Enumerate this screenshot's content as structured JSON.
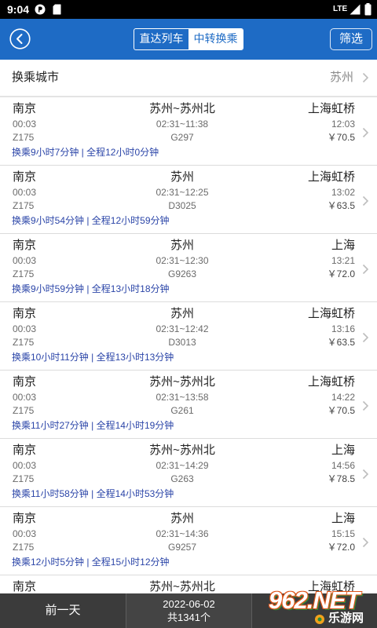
{
  "status_bar": {
    "time": "9:04",
    "network": "LTE",
    "icons": {
      "app": "app-notification-icon",
      "sim": "sim-card-icon",
      "signal": "signal-icon",
      "battery": "battery-icon"
    }
  },
  "header": {
    "back_icon": "back-circle-icon",
    "tabs": [
      {
        "label": "直达列车",
        "selected": false
      },
      {
        "label": "中转换乘",
        "selected": true
      }
    ],
    "filter_label": "筛选"
  },
  "transfer_city": {
    "label": "换乘城市",
    "value": "苏州",
    "icon": "chevron-right-icon"
  },
  "results": [
    {
      "from": "南京",
      "via": "苏州~苏州北",
      "to": "上海虹桥",
      "depart": "00:03",
      "transfer": "02:31~11:38",
      "arrive": "12:03",
      "train1": "Z175",
      "train2": "G297",
      "price": "￥70.5",
      "summary": "换乘9小时7分钟 | 全程12小时0分钟"
    },
    {
      "from": "南京",
      "via": "苏州",
      "to": "上海虹桥",
      "depart": "00:03",
      "transfer": "02:31~12:25",
      "arrive": "13:02",
      "train1": "Z175",
      "train2": "D3025",
      "price": "￥63.5",
      "summary": "换乘9小时54分钟 | 全程12小时59分钟"
    },
    {
      "from": "南京",
      "via": "苏州",
      "to": "上海",
      "depart": "00:03",
      "transfer": "02:31~12:30",
      "arrive": "13:21",
      "train1": "Z175",
      "train2": "G9263",
      "price": "￥72.0",
      "summary": "换乘9小时59分钟 | 全程13小时18分钟"
    },
    {
      "from": "南京",
      "via": "苏州",
      "to": "上海虹桥",
      "depart": "00:03",
      "transfer": "02:31~12:42",
      "arrive": "13:16",
      "train1": "Z175",
      "train2": "D3013",
      "price": "￥63.5",
      "summary": "换乘10小时11分钟 | 全程13小时13分钟"
    },
    {
      "from": "南京",
      "via": "苏州~苏州北",
      "to": "上海虹桥",
      "depart": "00:03",
      "transfer": "02:31~13:58",
      "arrive": "14:22",
      "train1": "Z175",
      "train2": "G261",
      "price": "￥70.5",
      "summary": "换乘11小时27分钟 | 全程14小时19分钟"
    },
    {
      "from": "南京",
      "via": "苏州~苏州北",
      "to": "上海",
      "depart": "00:03",
      "transfer": "02:31~14:29",
      "arrive": "14:56",
      "train1": "Z175",
      "train2": "G263",
      "price": "￥78.5",
      "summary": "换乘11小时58分钟 | 全程14小时53分钟"
    },
    {
      "from": "南京",
      "via": "苏州",
      "to": "上海",
      "depart": "00:03",
      "transfer": "02:31~14:36",
      "arrive": "15:15",
      "train1": "Z175",
      "train2": "G9257",
      "price": "￥72.0",
      "summary": "换乘12小时5分钟 | 全程15小时12分钟"
    },
    {
      "from": "南京",
      "via": "苏州~苏州北",
      "to": "上海虹桥"
    }
  ],
  "bottom_bar": {
    "prev_label": "前一天",
    "date": "2022-06-02",
    "total": "共1341个"
  },
  "watermark": {
    "brand": "962.NET",
    "name": "乐游网"
  },
  "colors": {
    "header": "#1E6BC5",
    "summary_text": "#2B45A8",
    "bottom_bar": "#3B3B3B"
  }
}
